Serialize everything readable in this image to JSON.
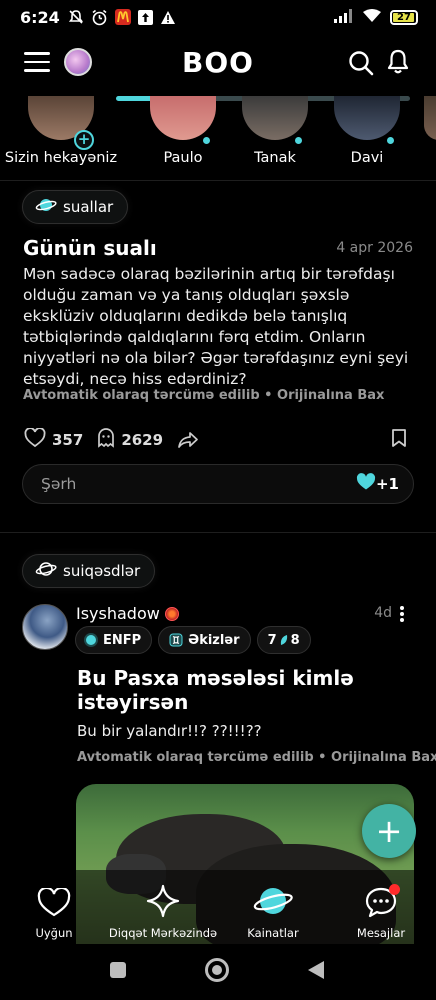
{
  "status_bar": {
    "time": "6:24",
    "battery": "27",
    "icons": [
      "mute-icon",
      "alarm-icon",
      "mcdonalds-icon",
      "upload-icon",
      "warning-icon",
      "signal-icon",
      "wifi-icon",
      "battery-icon"
    ]
  },
  "header": {
    "logo": "BOO"
  },
  "stories": [
    {
      "name": "Sizin hekayəniz",
      "colors": [
        "#5a4437",
        "#9c7a66"
      ]
    },
    {
      "name": "Paulo",
      "colors": [
        "#c76d6d",
        "#e09a90"
      ]
    },
    {
      "name": "Tanak",
      "colors": [
        "#3b3b3b",
        "#7a6d64"
      ]
    },
    {
      "name": "Davi",
      "colors": [
        "#1f2633",
        "#4e5a70"
      ]
    }
  ],
  "question_post": {
    "tag": "suallar",
    "title": "Günün sualı",
    "date": "4 apr 2026",
    "body": "Mən sadəcə olaraq bəzilərinin artıq bir tərəfdaşı olduğu zaman və ya tanış olduqları şəxslə eksklüziv olduqlarını dedikdə belə tanışlıq tətbiqlərində qaldıqlarını fərq etdim. Onların niyyətləri nə ola bilər? Əgər tərəfdaşınız eyni şeyi etsəydi, necə hiss edərdiniz?",
    "auto_translated": "Avtomatik olaraq tərcümə edilib",
    "see_original": "Orijinalına Bax",
    "likes": "357",
    "comments": "2629",
    "comment_placeholder": "Şərh",
    "plus_one": "+1"
  },
  "post": {
    "tag": "suiqəsdlər",
    "username": "Isyshadow",
    "time": "4d",
    "chips": {
      "mbti": "ENFP",
      "zodiac": "Əkizlər",
      "enneagram": "7",
      "enneagram_wing": "8"
    },
    "title": "Bu Pasxa məsələsi kimlə istəyirsən",
    "text": "Bu bir yalandır!!? ??!!!??",
    "auto_translated": "Avtomatik olaraq tərcümə edilib",
    "see_original": "Orijinalına Bax"
  },
  "fab": {
    "label": "+"
  },
  "bottom_nav": [
    {
      "label": "Uyğun",
      "icon": "heart-icon"
    },
    {
      "label": "Diqqət Mərkəzində",
      "icon": "sparkle-icon"
    },
    {
      "label": "Kainatlar",
      "icon": "planet-icon"
    },
    {
      "label": "Mesajlar",
      "icon": "chat-icon"
    }
  ],
  "colors": {
    "accent": "#4fd6dd",
    "fab": "#43b3a4",
    "badge": "#ff2b2b"
  }
}
